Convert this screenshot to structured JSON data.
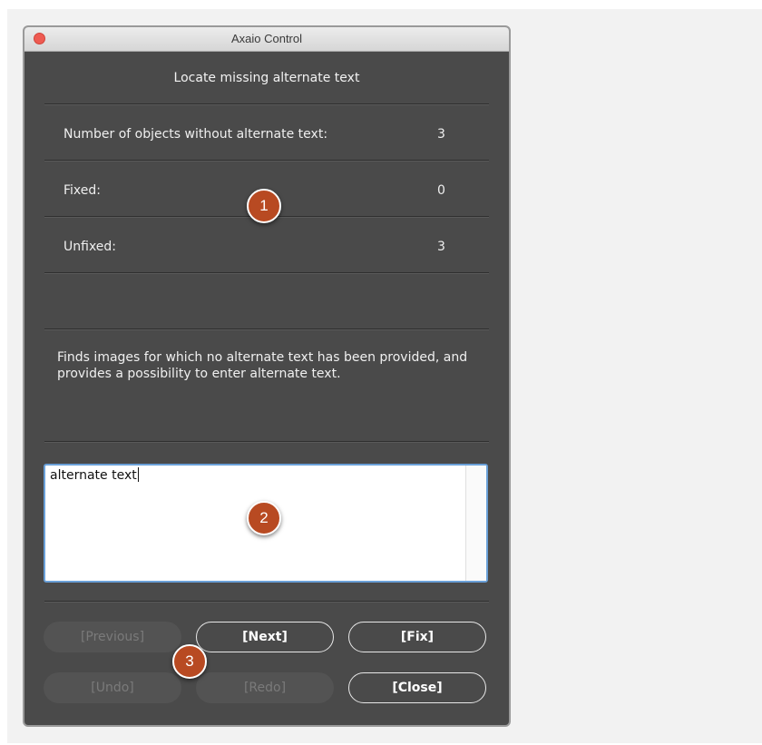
{
  "window": {
    "title": "Axaio Control"
  },
  "dialog": {
    "heading": "Locate missing alternate text",
    "stats": [
      {
        "label": "Number of objects without alternate text:",
        "value": "3"
      },
      {
        "label": "Fixed:",
        "value": "0"
      },
      {
        "label": "Unfixed:",
        "value": "3"
      }
    ],
    "description": "Finds images for which no alternate text has been provided, and provides a possibility to enter alternate text.",
    "alt_text_value": "alternate text"
  },
  "buttons": {
    "previous": "[Previous]",
    "next": "[Next]",
    "fix": "[Fix]",
    "undo": "[Undo]",
    "redo": "[Redo]",
    "close": "[Close]"
  },
  "callouts": [
    "1",
    "2",
    "3"
  ],
  "colors": {
    "panel": "#4a4a4a",
    "callout": "#b84a22",
    "focus_ring": "#6aa0d8"
  }
}
